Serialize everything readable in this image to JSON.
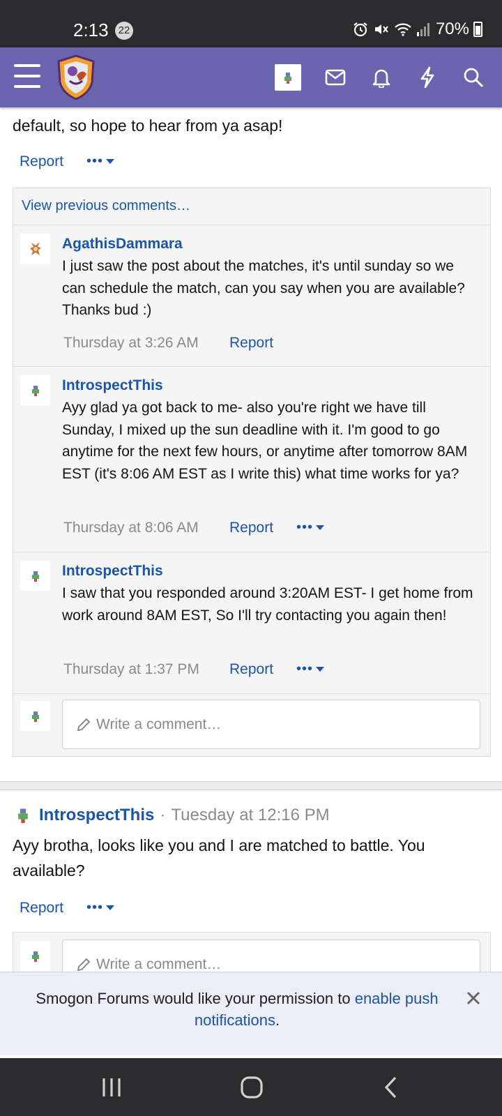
{
  "status_bar": {
    "time": "2:13",
    "notification_count": "22",
    "battery": "70%"
  },
  "header": {
    "logo_icon": "smogon-shield-logo",
    "icons": [
      "avatar",
      "mail-icon",
      "bell-icon",
      "bolt-icon",
      "search-icon"
    ]
  },
  "top_post": {
    "text_tail": "default, so hope to hear from ya asap!",
    "report_label": "Report",
    "more_label": "•••"
  },
  "comments": {
    "view_previous": "View previous comments…",
    "items": [
      {
        "user": "AgathisDammara",
        "text": "I just saw the post about the matches, it's until sunday so we can schedule the match, can you say when you are available? Thanks bud :)",
        "time": "Thursday at 3:26 AM",
        "report": "Report"
      },
      {
        "user": "IntrospectThis",
        "text": "Ayy glad ya got back to me- also you're right we have till Sunday, I mixed up the sun deadline with it. I'm good to go anytime for the next few hours, or anytime after tomorrow 8AM EST (it's 8:06 AM EST as I write this) what time works for ya?",
        "time": "Thursday at 8:06 AM",
        "report": "Report",
        "more": "•••"
      },
      {
        "user": "IntrospectThis",
        "text": "I saw that you responded around 3:20AM EST- I get home from work around 8AM EST, So I'll try contacting you again then!",
        "time": "Thursday at 1:37 PM",
        "report": "Report",
        "more": "•••"
      }
    ],
    "write_placeholder": "Write a comment…"
  },
  "second_post": {
    "user": "IntrospectThis",
    "separator": "·",
    "time": "Tuesday at 12:16 PM",
    "text": "Ayy brotha, looks like you and I are matched to battle. You available?",
    "report_label": "Report",
    "more_label": "•••",
    "write_placeholder": "Write a comment…"
  },
  "push_banner": {
    "text_before": "Smogon Forums would like your permission to ",
    "link_text": "enable push notifications",
    "text_after": "."
  },
  "colors": {
    "header": "#6b65b0",
    "link": "#1a55a8",
    "status_bar": "#2b2b2e"
  }
}
